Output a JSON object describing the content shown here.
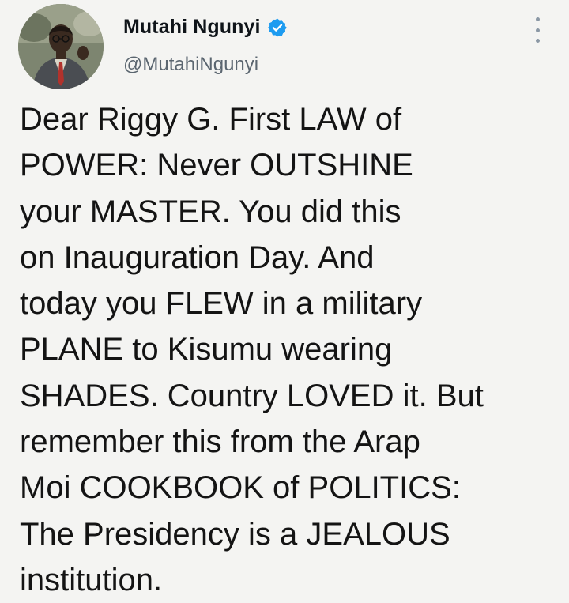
{
  "author": {
    "display_name": "Mutahi Ngunyi",
    "handle": "@MutahiNgunyi",
    "verified": true
  },
  "tweet": {
    "lines": [
      "Dear Riggy G. First LAW of",
      "POWER: Never OUTSHINE",
      "your MASTER. You did this",
      "on Inauguration Day. And",
      "today you FLEW in a military",
      "PLANE to Kisumu wearing",
      "SHADES. Country LOVED it. But",
      "remember this from the Arap",
      "Moi COOKBOOK of POLITICS:",
      "The Presidency is a JEALOUS",
      "institution."
    ]
  },
  "icons": {
    "verified": "verified-badge-icon",
    "more": "more-options-icon"
  },
  "colors": {
    "background": "#f4f4f2",
    "text": "#141414",
    "handle": "#5b6670",
    "verified": "#1d9bf0"
  }
}
